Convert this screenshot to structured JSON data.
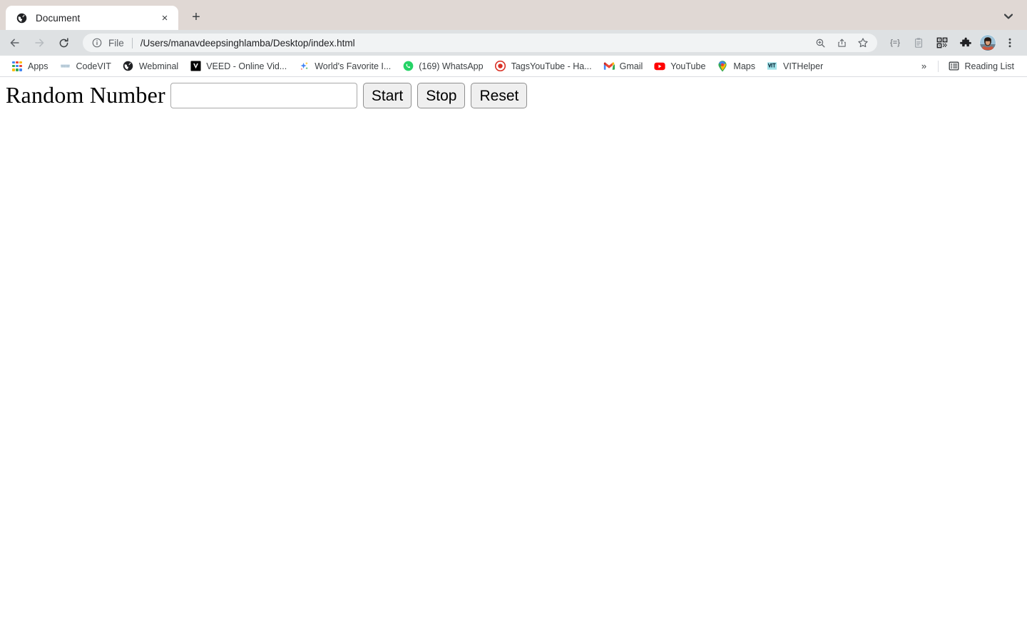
{
  "browser": {
    "tab": {
      "title": "Document",
      "favicon": "globe-icon",
      "close_label": "×"
    },
    "new_tab_label": "+",
    "tab_search_icon": "chevron-down-icon",
    "nav": {
      "back_icon": "back-arrow-icon",
      "forward_icon": "forward-arrow-icon",
      "reload_icon": "reload-icon"
    },
    "omnibox": {
      "info_icon": "info-circle-icon",
      "scheme_label": "File",
      "url": "/Users/manavdeepsinghlamba/Desktop/index.html",
      "actions": [
        "zoom-in-icon",
        "share-icon",
        "star-icon"
      ]
    },
    "toolbar_icons": [
      "autofill-icon",
      "clipboard-icon",
      "qr-code-icon",
      "extensions-puzzle-icon",
      "profile-avatar",
      "three-dot-menu-icon"
    ],
    "autofill_glyph": "{=}",
    "bookmarks": [
      {
        "label": "Apps",
        "icon": "apps-grid-icon"
      },
      {
        "label": "CodeVIT",
        "icon": "codevit-favicon"
      },
      {
        "label": "Webminal",
        "icon": "webminal-globe-favicon"
      },
      {
        "label": "VEED - Online Vid...",
        "icon": "veed-favicon"
      },
      {
        "label": "World's Favorite I...",
        "icon": "worlds-favorite-favicon"
      },
      {
        "label": "(169) WhatsApp",
        "icon": "whatsapp-favicon"
      },
      {
        "label": "TagsYouTube - Ha...",
        "icon": "tagsyoutube-favicon"
      },
      {
        "label": "Gmail",
        "icon": "gmail-favicon"
      },
      {
        "label": "YouTube",
        "icon": "youtube-favicon"
      },
      {
        "label": "Maps",
        "icon": "maps-favicon"
      },
      {
        "label": "VITHelper",
        "icon": "vithelper-favicon"
      }
    ],
    "bookmarks_overflow_label": "»",
    "reading_list": {
      "label": "Reading List",
      "icon": "reading-list-icon"
    }
  },
  "page": {
    "heading": "Random Number",
    "number_input": {
      "value": "",
      "placeholder": ""
    },
    "buttons": {
      "start": "Start",
      "stop": "Stop",
      "reset": "Reset"
    }
  },
  "colors": {
    "tabstrip_bg": "#e0d8d4",
    "toolbar_bg": "#dee1e3",
    "omnibox_bg": "#f1f3f4",
    "page_bg": "#ffffff",
    "button_bg": "#efefef"
  }
}
